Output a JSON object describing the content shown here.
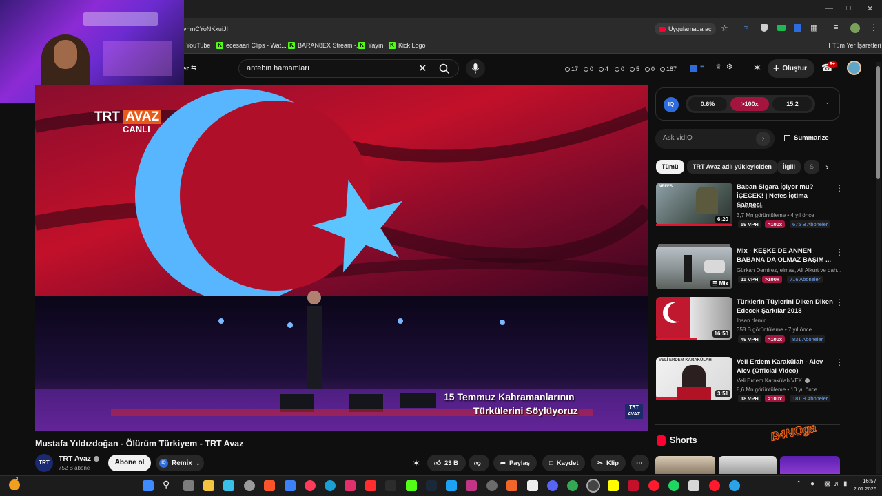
{
  "browser": {
    "url_fragment": "v=mCYoNKxuiJI",
    "open_in_app": "Uygulamada aç",
    "bookmarks": [
      "YouTube",
      "ecesaari Clips - Wat...",
      "BARAN8EX Stream -...",
      "Yayın",
      "Kick Logo"
    ],
    "all_bookmarks": "Tüm Yer İşaretleri",
    "colors": {
      "kick": "#53fc18",
      "youtube": "#ff0033"
    }
  },
  "header": {
    "filter_label": "er",
    "search_value": "antebin hamamları",
    "stats": [
      "17",
      "0",
      "4",
      "0",
      "5",
      "0",
      "187"
    ],
    "create_label": "Oluştur",
    "notifications": "9+"
  },
  "video": {
    "channel_logo_top": "TRT",
    "channel_logo_accent": "AVAZ",
    "live_label": "CANLI",
    "subtitle_line1": "15 Temmuz Kahramanlarının",
    "subtitle_line2": "Türkülerini Söylüyoruz",
    "corner_logo_top": "TRT",
    "corner_logo_bottom": "AVAZ",
    "title": "Mustafa Yıldızdoğan - Ölürüm Türkiyem - TRT Avaz"
  },
  "channel": {
    "avatar_text": "TRT",
    "name": "TRT Avaz",
    "subscribers": "752 B abone",
    "subscribe_label": "Abone ol",
    "remix_label": "Remix"
  },
  "actions": {
    "likes": "23 B",
    "share": "Paylaş",
    "save": "Kaydet",
    "clip": "Klip"
  },
  "vidiq": {
    "badge": "IQ",
    "scores": [
      "0.6%",
      ">100x",
      "15.2"
    ],
    "ask_placeholder": "Ask vidIQ",
    "summarize": "Summarize"
  },
  "filter_chips": [
    "Tümü",
    "TRT Avaz adlı yükleyiciden",
    "İlgili",
    "S"
  ],
  "recommendations": [
    {
      "thumb_label": "NEFES",
      "title": "Baban Sigara İçiyor mu? İÇECEK! | Nefes İçtima Sahnesi",
      "channel": "Film Adresi",
      "meta": "3,7 Mn görüntüleme • 4 yıl önce",
      "vph": "59 VPH",
      "multiplier": ">100x",
      "subs": "675 B Aboneler",
      "duration": "6:20"
    },
    {
      "thumb_label": "",
      "title": "Mix - KEŞKE DE ANNEN BABANA DA OLMAZ BAŞIM ...",
      "channel": "Gürkan Demirez, elmas, Ali Alkurt ve dah...",
      "meta": "",
      "vph": "11 VPH",
      "multiplier": ">100x",
      "subs": "716 Aboneler",
      "duration": "Mix"
    },
    {
      "thumb_label": "",
      "title": "Türklerin Tüylerini Diken Diken Edecek Şarkılar 2018",
      "channel": "İhsan demir",
      "meta": "358 B görüntüleme • 7 yıl önce",
      "vph": "49 VPH",
      "multiplier": ">100x",
      "subs": "831 Aboneler",
      "duration": "16:50"
    },
    {
      "thumb_label": "VELİ ERDEM KARAKÜLAH",
      "title": "Veli Erdem Karakülah - Alev Alev (Official Video)",
      "channel": "Veli Erdem Karakülah VEK",
      "meta": "8,6 Mn görüntüleme • 10 yıl önce",
      "vph": "18 VPH",
      "multiplier": ">100x",
      "subs": "181 B Aboneler",
      "duration": "3:51"
    }
  ],
  "shorts_label": "Shorts",
  "overlay_logo": "B4NOga",
  "taskbar": {
    "weather_badge": "3",
    "time": "16:57",
    "date": "2.01.2026"
  }
}
